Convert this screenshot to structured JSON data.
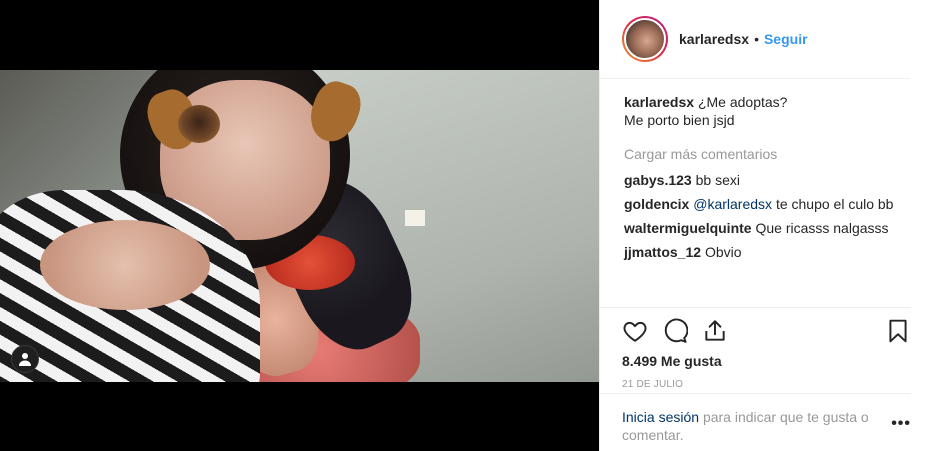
{
  "post": {
    "username": "karlaredsx",
    "separator": "•",
    "follow_label": "Seguir"
  },
  "caption": {
    "author": "karlaredsx",
    "text_line1": "¿Me adoptas?",
    "text_line2": "Me porto bien jsjd"
  },
  "load_more_label": "Cargar más comentarios",
  "comments": [
    {
      "author": "gabys.123",
      "text": "bb sexi"
    },
    {
      "author": "goldencix",
      "mention": "@karlaredsx",
      "text": "te chupo el culo bb"
    },
    {
      "author": "waltermiguelquinte",
      "text": "Que ricasss nalgasss"
    },
    {
      "author": "jjmattos_12",
      "text": "Obvio"
    }
  ],
  "stats": {
    "likes": "8.499 Me gusta",
    "date": "21 DE JULIO"
  },
  "login_prompt": {
    "link_label": "Inicia sesión",
    "text": "para indicar que te gusta o comentar."
  },
  "more_options_label": "•••",
  "icons": {
    "like": "heart-icon",
    "comment": "comment-icon",
    "share": "share-icon",
    "save": "bookmark-icon",
    "user_tag": "user-tag-icon"
  },
  "colors": {
    "link": "#3897f0",
    "mention": "#003569",
    "muted": "#999999",
    "text": "#262626"
  }
}
